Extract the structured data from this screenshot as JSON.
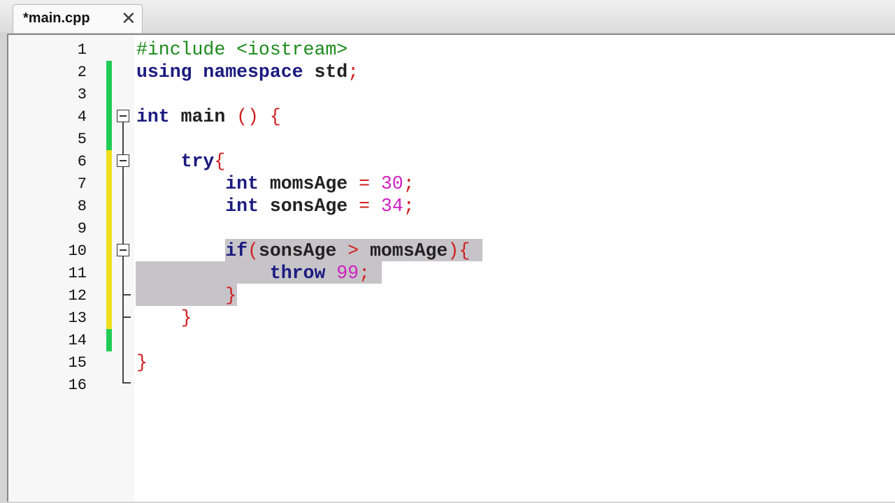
{
  "tab": {
    "label": "*main.cpp",
    "close": "✕"
  },
  "colors": {
    "added": "#22cc55",
    "modified": "#f0e020",
    "selection": "#c6c4c8"
  },
  "lines": [
    [
      {
        "t": "#include <iostream>",
        "c": "pp"
      }
    ],
    [
      {
        "t": "using namespace ",
        "c": "k"
      },
      {
        "t": "std",
        "c": "i"
      },
      {
        "t": ";",
        "c": "p"
      }
    ],
    [],
    [
      {
        "t": "int ",
        "c": "k"
      },
      {
        "t": "main ",
        "c": "i"
      },
      {
        "t": "() {",
        "c": "p"
      }
    ],
    [],
    [
      {
        "t": "    try",
        "c": "k"
      },
      {
        "t": "{",
        "c": "p"
      }
    ],
    [
      {
        "t": "        int ",
        "c": "k"
      },
      {
        "t": "momsAge ",
        "c": "i"
      },
      {
        "t": "= ",
        "c": "p"
      },
      {
        "t": "30",
        "c": "n"
      },
      {
        "t": ";",
        "c": "p"
      }
    ],
    [
      {
        "t": "        int ",
        "c": "k"
      },
      {
        "t": "sonsAge ",
        "c": "i"
      },
      {
        "t": "= ",
        "c": "p"
      },
      {
        "t": "34",
        "c": "n"
      },
      {
        "t": ";",
        "c": "p"
      }
    ],
    [],
    [
      {
        "t": "        if",
        "c": "k"
      },
      {
        "t": "(",
        "c": "p"
      },
      {
        "t": "sonsAge ",
        "c": "i"
      },
      {
        "t": "> ",
        "c": "p"
      },
      {
        "t": "momsAge",
        "c": "i"
      },
      {
        "t": "){",
        "c": "p"
      }
    ],
    [
      {
        "t": "            throw ",
        "c": "k"
      },
      {
        "t": "99",
        "c": "n"
      },
      {
        "t": ";",
        "c": "p"
      }
    ],
    [
      {
        "t": "        }",
        "c": "p"
      }
    ],
    [
      {
        "t": "    }",
        "c": "p"
      }
    ],
    [],
    [
      {
        "t": "}",
        "c": "p"
      }
    ],
    []
  ]
}
